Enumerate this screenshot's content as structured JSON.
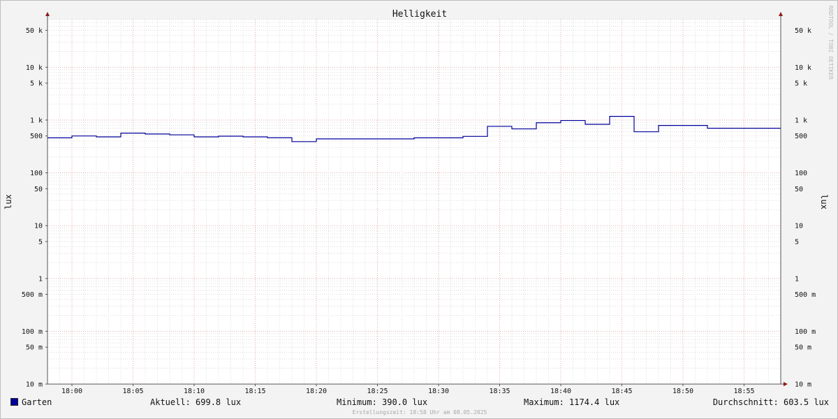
{
  "chart_data": {
    "type": "line",
    "title": "Helligkeit",
    "ylabel": "lux",
    "ylabel_right": "lux",
    "yscale": "log",
    "ylim": [
      0.01,
      80000
    ],
    "y_ticks": [
      {
        "value": 50000,
        "label": "50 k"
      },
      {
        "value": 10000,
        "label": "10 k"
      },
      {
        "value": 5000,
        "label": "5 k"
      },
      {
        "value": 1000,
        "label": "1 k"
      },
      {
        "value": 500,
        "label": "500"
      },
      {
        "value": 100,
        "label": "100"
      },
      {
        "value": 50,
        "label": "50"
      },
      {
        "value": 10,
        "label": "10"
      },
      {
        "value": 5,
        "label": "5"
      },
      {
        "value": 1,
        "label": "1"
      },
      {
        "value": 0.5,
        "label": "500 m"
      },
      {
        "value": 0.1,
        "label": "100 m"
      },
      {
        "value": 0.05,
        "label": "50 m"
      },
      {
        "value": 0.01,
        "label": "10 m"
      }
    ],
    "x_ticks": [
      "18:00",
      "18:05",
      "18:10",
      "18:15",
      "18:20",
      "18:25",
      "18:30",
      "18:35",
      "18:40",
      "18:45",
      "18:50",
      "18:55"
    ],
    "xlim": [
      "17:58",
      "18:58"
    ],
    "grid": true,
    "line_color": "#0000a0",
    "series": [
      {
        "name": "Garten",
        "color": "#00009c",
        "points": [
          {
            "x": "17:58",
            "y": 460
          },
          {
            "x": "18:00",
            "y": 500
          },
          {
            "x": "18:02",
            "y": 480
          },
          {
            "x": "18:04",
            "y": 565
          },
          {
            "x": "18:06",
            "y": 545
          },
          {
            "x": "18:08",
            "y": 525
          },
          {
            "x": "18:10",
            "y": 480
          },
          {
            "x": "18:12",
            "y": 495
          },
          {
            "x": "18:14",
            "y": 480
          },
          {
            "x": "18:16",
            "y": 462
          },
          {
            "x": "18:18",
            "y": 390
          },
          {
            "x": "18:20",
            "y": 440
          },
          {
            "x": "18:22",
            "y": 440
          },
          {
            "x": "18:24",
            "y": 440
          },
          {
            "x": "18:26",
            "y": 440
          },
          {
            "x": "18:28",
            "y": 460
          },
          {
            "x": "18:30",
            "y": 460
          },
          {
            "x": "18:32",
            "y": 490
          },
          {
            "x": "18:34",
            "y": 760
          },
          {
            "x": "18:36",
            "y": 680
          },
          {
            "x": "18:38",
            "y": 890
          },
          {
            "x": "18:40",
            "y": 980
          },
          {
            "x": "18:42",
            "y": 830
          },
          {
            "x": "18:44",
            "y": 1174
          },
          {
            "x": "18:46",
            "y": 600
          },
          {
            "x": "18:48",
            "y": 790
          },
          {
            "x": "18:50",
            "y": 790
          },
          {
            "x": "18:52",
            "y": 700
          },
          {
            "x": "18:54",
            "y": 700
          },
          {
            "x": "18:56",
            "y": 700
          },
          {
            "x": "18:58",
            "y": 700
          }
        ]
      }
    ]
  },
  "legend": {
    "series_label": "Garten",
    "aktuell": "Aktuell: 699.8 lux",
    "minimum": "Minimum: 390.0 lux",
    "maximum": "Maximum: 1174.4 lux",
    "durchschnitt": "Durchschnitt: 603.5 lux"
  },
  "footer": "Erstellungszeit: 18:58 Uhr am 08.05.2025",
  "watermark": "RRDTOOL / TOBI OETIKER"
}
